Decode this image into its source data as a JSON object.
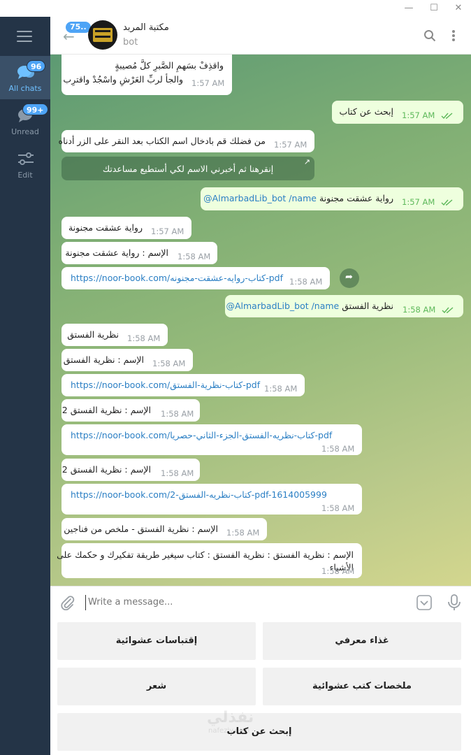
{
  "window": {
    "controls": [
      "—",
      "☐",
      "✕"
    ]
  },
  "sidebar": {
    "folders": [
      {
        "label": "All chats",
        "badge": "96",
        "badge_color": "#4ea4f6"
      },
      {
        "label": "Unread",
        "badge": "99+",
        "badge_color": "#4ea4f6"
      },
      {
        "label": "Edit"
      }
    ]
  },
  "header": {
    "back_badge": "75..",
    "chat_name": "مكتبة المربد",
    "status": "bot"
  },
  "messages": [
    {
      "dir": "in",
      "lines": [
        "واقذِفْ بسَهمِ الصَّبرِ كلَّ مُصيبةٍ",
        "والجأ لربِّ العَرْشِ واسْجُدْ واقترِب"
      ],
      "time": "1:57 AM"
    },
    {
      "dir": "out",
      "text": "إبحث عن كتاب",
      "time": "1:57 AM"
    },
    {
      "dir": "in",
      "text": "من فضلك قم بادخال اسم الكتاب بعد النقر على الزر أدناه",
      "time": "1:57 AM",
      "button": "إنقرهنا ثم أخبرني الاسم لكي أستطيع مساعدتك"
    },
    {
      "dir": "out",
      "prefix": "@AlmarbadLib_bot /name",
      "text": "رواية عشقت مجنونة",
      "time": "1:57 AM"
    },
    {
      "dir": "in",
      "text": "رواية عشقت مجنونة",
      "time": "1:57 AM"
    },
    {
      "dir": "in",
      "text": "الإسم : رواية عشقت مجنونة",
      "time": "1:58 AM"
    },
    {
      "dir": "in",
      "link": "https://noor-book.com/كتاب-روايه-عشقت-مجنونه-pdf",
      "time": "1:58 AM"
    },
    {
      "dir": "out",
      "prefix": "@AlmarbadLib_bot /name",
      "text": "نظرية الفستق",
      "time": "1:58 AM"
    },
    {
      "dir": "in",
      "text": "نظرية الفستق",
      "time": "1:58 AM"
    },
    {
      "dir": "in",
      "text": "الإسم : نظرية الفستق",
      "time": "1:58 AM"
    },
    {
      "dir": "in",
      "link": "https://noor-book.com/كتاب-نظرية-الفستق-pdf",
      "time": "1:58 AM"
    },
    {
      "dir": "in",
      "text": "الإسم : نظرية الفستق 2",
      "time": "1:58 AM"
    },
    {
      "dir": "in",
      "link": "https://noor-book.com/كتاب-نظريه-الفستق-الجزء-الثاني-حصريا-pdf",
      "time": "1:58 AM"
    },
    {
      "dir": "in",
      "text": "الإسم : نظرية الفستق 2",
      "time": "1:58 AM"
    },
    {
      "dir": "in",
      "link": "https://noor-book.com/كتاب-نظريه-الفستق-2-pdf-1614005999",
      "time": "1:58 AM"
    },
    {
      "dir": "in",
      "text": "الإسم : نظرية الفستق - ملخص من فناجين",
      "time": "1:58 AM"
    },
    {
      "dir": "in",
      "lines": [
        "الإسم : نظرية الفستق : نظرية الفستق : كتاب سيغير طريقة تفكيرك و حكمك على",
        "الأشياء"
      ],
      "time": "1:58 AM"
    }
  ],
  "composer": {
    "placeholder": "Write a message..."
  },
  "keyboard": {
    "buttons": [
      "غذاء معرفي",
      "إقتباسات عشوائية",
      "ملخصات كتب عشوائية",
      "شعر",
      "إبحث عن كتاب"
    ]
  },
  "watermark": {
    "text": "نفذلي",
    "sub": "nafezly.com"
  }
}
